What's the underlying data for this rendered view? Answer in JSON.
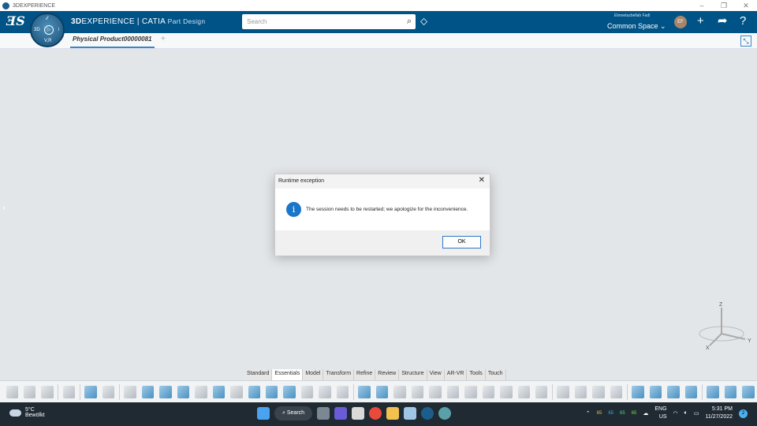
{
  "window": {
    "title": "3DEXPERIENCE",
    "controls": [
      "–",
      "❐",
      "✕"
    ]
  },
  "topbar": {
    "brand_bold": "3D",
    "brand_rest": "EXPERIENCE | CATIA",
    "app": "Part Design",
    "compass_labels": {
      "top": "⁄⁄",
      "left": "3D",
      "bottom": "V,R",
      "right": "i"
    },
    "search_placeholder": "Search",
    "user": "Elmoetazbellah Fadl",
    "space": "Common Space ⌄",
    "avatar": "EF"
  },
  "tabs": {
    "current": "Physical Product00000081",
    "add": "+"
  },
  "dialog": {
    "title": "Runtime exception",
    "message": "The session needs to be restarted; we apologize for the inconvenience.",
    "ok": "OK",
    "icon": "info-icon"
  },
  "axis": {
    "z": "Z",
    "y": "Y",
    "x": "X"
  },
  "workbench_tabs": [
    {
      "label": "Standard"
    },
    {
      "label": "Essentials",
      "active": true
    },
    {
      "label": "Model"
    },
    {
      "label": "Transform"
    },
    {
      "label": "Refine"
    },
    {
      "label": "Review"
    },
    {
      "label": "Structure"
    },
    {
      "label": "View"
    },
    {
      "label": "AR-VR"
    },
    {
      "label": "Tools"
    },
    {
      "label": "Touch"
    }
  ],
  "taskbar": {
    "temp": "5°C",
    "weather": "Bewölkt",
    "search": "Search",
    "lang1": "ENG",
    "lang2": "US",
    "time": "5:31 PM",
    "date": "11/27/2022",
    "notifications": "2",
    "tray_nums": [
      "65",
      "65",
      "65",
      "65"
    ]
  },
  "colors": {
    "topbar": "#005386",
    "accent": "#3a87c2",
    "info": "#1976c8"
  }
}
